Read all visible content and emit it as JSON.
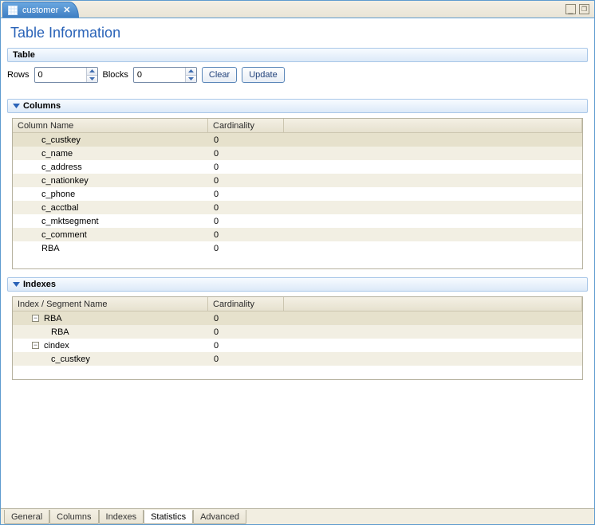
{
  "top_tab": {
    "label": "customer",
    "icon": "table-icon"
  },
  "window_buttons": {
    "minimize": "_",
    "maximize": "❐"
  },
  "page_title": "Table Information",
  "sections": {
    "table": {
      "title": "Table",
      "rows_label": "Rows",
      "rows_value": "0",
      "blocks_label": "Blocks",
      "blocks_value": "0",
      "clear_label": "Clear",
      "update_label": "Update"
    },
    "columns": {
      "title": "Columns",
      "headers": {
        "name": "Column Name",
        "cardinality": "Cardinality"
      },
      "rows": [
        {
          "name": "c_custkey",
          "cardinality": "0",
          "selected": true
        },
        {
          "name": "c_name",
          "cardinality": "0"
        },
        {
          "name": "c_address",
          "cardinality": "0"
        },
        {
          "name": "c_nationkey",
          "cardinality": "0"
        },
        {
          "name": "c_phone",
          "cardinality": "0"
        },
        {
          "name": "c_acctbal",
          "cardinality": "0"
        },
        {
          "name": "c_mktsegment",
          "cardinality": "0"
        },
        {
          "name": "c_comment",
          "cardinality": "0"
        },
        {
          "name": "RBA",
          "cardinality": "0"
        }
      ]
    },
    "indexes": {
      "title": "Indexes",
      "headers": {
        "name": "Index / Segment Name",
        "cardinality": "Cardinality"
      },
      "rows": [
        {
          "name": "RBA",
          "cardinality": "0",
          "level": 1,
          "expanded": true,
          "selected": true
        },
        {
          "name": "RBA",
          "cardinality": "0",
          "level": 2
        },
        {
          "name": "cindex",
          "cardinality": "0",
          "level": 1,
          "expanded": true
        },
        {
          "name": "c_custkey",
          "cardinality": "0",
          "level": 2
        }
      ]
    }
  },
  "bottom_tabs": [
    {
      "label": "General",
      "active": false
    },
    {
      "label": "Columns",
      "active": false
    },
    {
      "label": "Indexes",
      "active": false
    },
    {
      "label": "Statistics",
      "active": true
    },
    {
      "label": "Advanced",
      "active": false
    }
  ]
}
